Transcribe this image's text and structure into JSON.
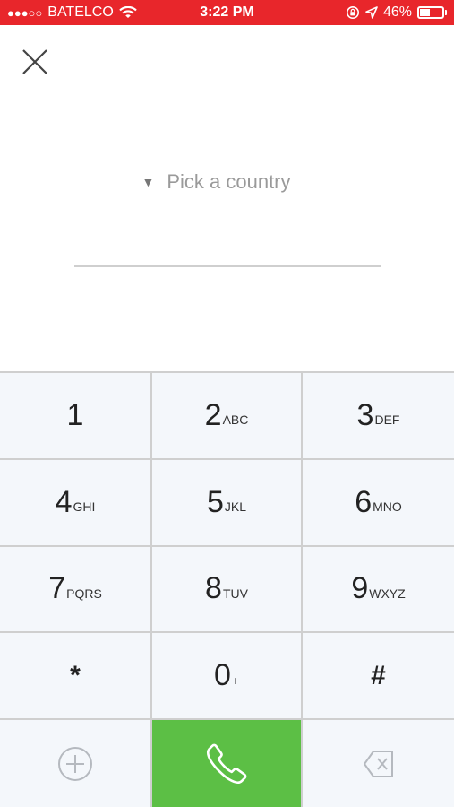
{
  "status_bar": {
    "signal": "●●●○○",
    "carrier": "BATELCO",
    "time": "3:22 PM",
    "battery_percent": "46%",
    "battery_level": 0.46
  },
  "icons": {
    "close": "close-icon",
    "country_dropdown": "triangle-down-icon",
    "add_contact": "plus-circle-icon",
    "call": "phone-icon",
    "backspace": "backspace-icon"
  },
  "country_picker": {
    "arrow": "▼",
    "label": "Pick a country"
  },
  "phone_input": {
    "value": "",
    "placeholder": ""
  },
  "keypad": {
    "keys": [
      {
        "digit": "1",
        "letters": ""
      },
      {
        "digit": "2",
        "letters": "ABC"
      },
      {
        "digit": "3",
        "letters": "DEF"
      },
      {
        "digit": "4",
        "letters": "GHI"
      },
      {
        "digit": "5",
        "letters": "JKL"
      },
      {
        "digit": "6",
        "letters": "MNO"
      },
      {
        "digit": "7",
        "letters": "PQRS"
      },
      {
        "digit": "8",
        "letters": "TUV"
      },
      {
        "digit": "9",
        "letters": "WXYZ"
      },
      {
        "digit": "*",
        "letters": ""
      },
      {
        "digit": "0",
        "letters": "+"
      },
      {
        "digit": "#",
        "letters": ""
      }
    ]
  },
  "colors": {
    "status_bar": "#e8262b",
    "call_button": "#5cbf45",
    "keypad_bg": "#f4f7fb",
    "divider": "#cfcfcf"
  }
}
